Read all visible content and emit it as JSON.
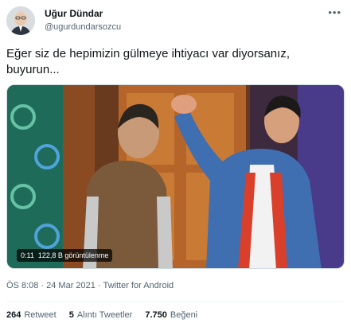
{
  "author": {
    "name": "Uğur Dündar",
    "handle": "@ugurdundarsozcu"
  },
  "more_icon": "more-horizontal-icon",
  "tweet": {
    "text": "Eğer siz de hepimizin gülmeye ihtiyacı var diyorsanız, buyurun..."
  },
  "media": {
    "duration": "0:11",
    "views": "122,8 B görüntülenme"
  },
  "meta": {
    "time": "ÖS 8:08",
    "separator": " · ",
    "date": "24 Mar 2021",
    "source": "Twitter for Android"
  },
  "stats": {
    "retweets_count": "264",
    "retweets_label": "Retweet",
    "quotes_count": "5",
    "quotes_label": "Alıntı Tweetler",
    "likes_count": "7.750",
    "likes_label": "Beğeni"
  },
  "colors": {
    "text": "#0f1419",
    "secondary": "#536471",
    "divider": "#eff3f4"
  }
}
